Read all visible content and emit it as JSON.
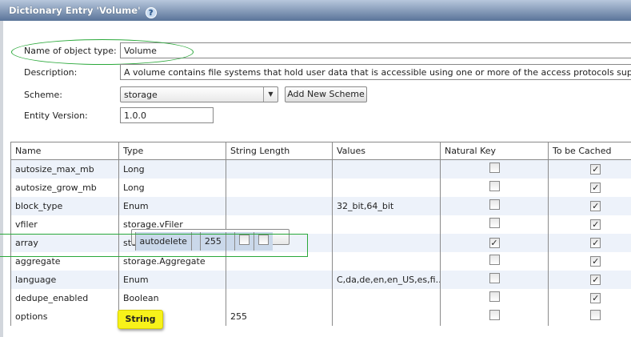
{
  "dialog": {
    "title": "Dictionary Entry 'Volume'",
    "help_icon": "?"
  },
  "form": {
    "name_label": "Name of object type:",
    "name_value": "Volume",
    "description_label": "Description:",
    "description_value": "A volume contains file systems that hold user data that is accessible using one or more of the access protocols supported by Data ON",
    "scheme_label": "Scheme:",
    "scheme_value": "storage",
    "add_scheme_label": "Add New Scheme",
    "version_label": "Entity Version:",
    "version_value": "1.0.0"
  },
  "table": {
    "columns": [
      "Name",
      "Type",
      "String Length",
      "Values",
      "Natural Key",
      "To be Cached"
    ],
    "rows": [
      {
        "name": "autosize_max_mb",
        "type": "Long",
        "length": "",
        "values": "",
        "natural_key": false,
        "cached": true
      },
      {
        "name": "autosize_grow_mb",
        "type": "Long",
        "length": "",
        "values": "",
        "natural_key": false,
        "cached": true
      },
      {
        "name": "block_type",
        "type": "Enum",
        "length": "",
        "values": "32_bit,64_bit",
        "natural_key": false,
        "cached": true
      },
      {
        "name": "vfiler",
        "type": "storage.vFiler",
        "length": "",
        "values": "",
        "natural_key": false,
        "cached": true
      },
      {
        "name": "array",
        "type": "storage.Array",
        "length": "",
        "values": "",
        "natural_key": true,
        "cached": true
      },
      {
        "name": "aggregate",
        "type": "storage.Aggregate",
        "length": "",
        "values": "",
        "natural_key": false,
        "cached": true
      },
      {
        "name": "language",
        "type": "Enum",
        "length": "",
        "values": "C,da,de,en,en_US,es,fi...",
        "natural_key": false,
        "cached": true
      },
      {
        "name": "dedupe_enabled",
        "type": "Boolean",
        "length": "",
        "values": "",
        "natural_key": false,
        "cached": true
      },
      {
        "name": "autodelete",
        "type": "",
        "length": "255",
        "values": "",
        "natural_key": false,
        "cached": false
      },
      {
        "name": "options",
        "type": "String",
        "length": "255",
        "values": "",
        "natural_key": false,
        "cached": false
      }
    ],
    "selected_row": 8
  },
  "tooltip": {
    "text": "String"
  }
}
